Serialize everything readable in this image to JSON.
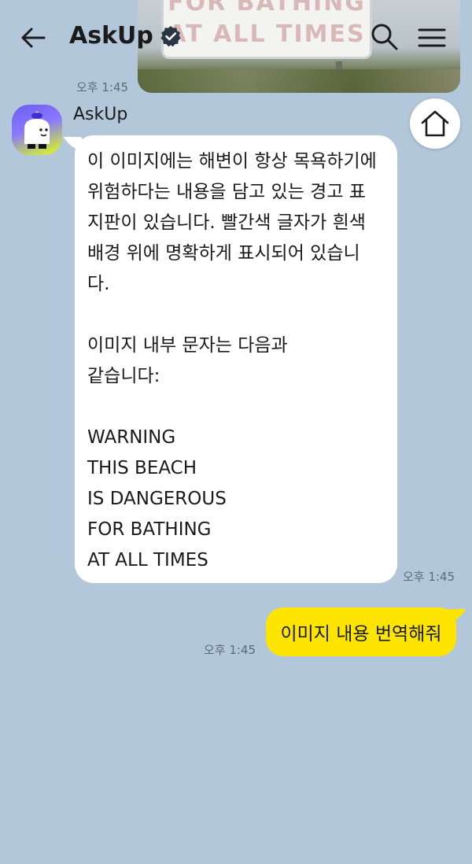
{
  "header": {
    "title": "AskUp",
    "back_icon": "arrow-left-icon",
    "verified_icon": "verified-badge-icon",
    "search_icon": "search-icon",
    "menu_icon": "hamburger-menu-icon"
  },
  "previous_message": {
    "type": "image",
    "sign_lines": [
      "FOR BATHING",
      "AT ALL TIMES"
    ],
    "time": "오후 1:45"
  },
  "bot_message": {
    "sender": "AskUp",
    "avatar_icon": "askup-bot-avatar",
    "text": "이 이미지에는 해변이 항상 목욕하기에\n위험하다는 내용을 담고 있는 경고 표\n지판이 있습니다. 빨간색 글자가 흰색\n배경 위에 명확하게 표시되어 있습니\n다.\n\n이미지 내부 문자는 다음과\n같습니다:\n\nWARNING\nTHIS BEACH\nIS DANGEROUS\nFOR BATHING\nAT ALL TIMES",
    "time": "오후 1:45"
  },
  "home_button": {
    "icon": "home-icon"
  },
  "user_message": {
    "text": "이미지 내용 번역해줘",
    "time": "오후 1:45"
  },
  "colors": {
    "background": "#b2c7da",
    "bot_bubble": "#ffffff",
    "user_bubble": "#fee500",
    "verified_badge": "#2a3644"
  }
}
